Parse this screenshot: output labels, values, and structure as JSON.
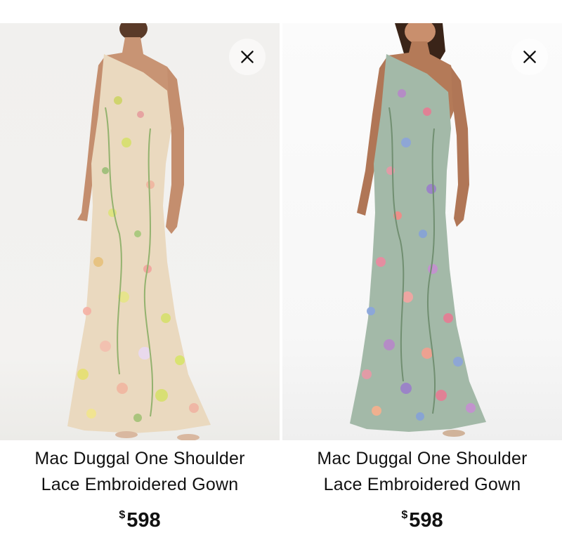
{
  "products": [
    {
      "title": "Mac Duggal One Shoulder Lace Embroidered Gown",
      "currency": "$",
      "price": "598",
      "dress_color": "#e9d8bd",
      "floral_accent": "#d8e070"
    },
    {
      "title": "Mac Duggal One Shoulder Lace Embroidered Gown",
      "currency": "$",
      "price": "598",
      "dress_color": "#9fb7a6",
      "floral_accent": "#e08aa0"
    }
  ],
  "icons": {
    "remove": "close-icon"
  }
}
